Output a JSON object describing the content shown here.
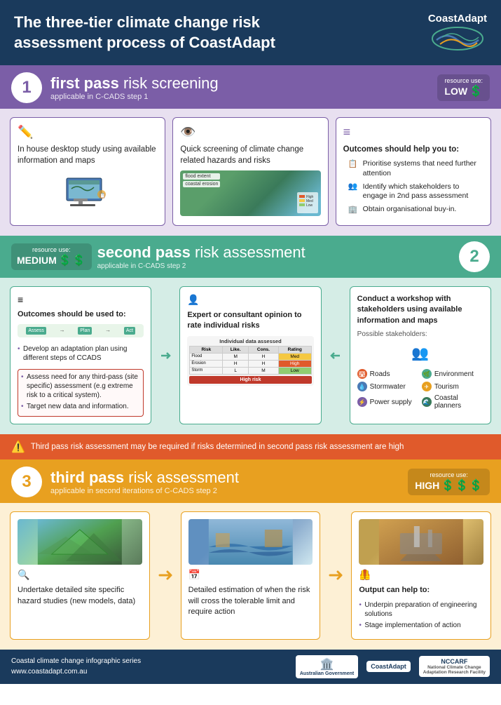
{
  "header": {
    "title": "The three-tier climate change risk assessment process of CoastAdapt",
    "logo_text": "CoastAdapt"
  },
  "first_pass": {
    "band_num": "1",
    "band_title_bold": "first pass",
    "band_title_rest": " risk screening",
    "band_subtitle": "applicable in C-CADS step 1",
    "resource_label": "resource use:",
    "resource_value": "LOW",
    "box1_title": "In house desktop study using available information and maps",
    "box2_title": "Quick screening of climate change related hazards and risks",
    "box3_title": "Outcomes should help you to:",
    "outcome1": "Prioritise systems that need further attention",
    "outcome2": "Identify which stakeholders to engage in 2nd pass assessment",
    "outcome3": "Obtain organisational buy-in."
  },
  "second_pass": {
    "band_num": "2",
    "band_title_bold": "second pass",
    "band_title_rest": " risk assessment",
    "band_subtitle": "applicable in C-CADS step 2",
    "resource_label": "resource use:",
    "resource_value": "MEDIUM",
    "box1_title": "Outcomes should be used to:",
    "box1_bullet1": "Develop an adaptation plan using different steps of CCADS",
    "box1_bullet2": "Assess need for any third-pass (site specific) assessment (e.g extreme risk to a critical system).",
    "box1_bullet3": "Target new data and information.",
    "box2_title": "Expert or consultant opinion to rate individual risks",
    "box3_title": "Conduct a workshop with stakeholders using available information and maps",
    "possible_stakeholders": "Possible stakeholders:",
    "s1": "Roads",
    "s2": "Environment",
    "s3": "Stormwater",
    "s4": "Tourism",
    "s5": "Power supply",
    "s6": "Coastal planners"
  },
  "warning": {
    "text": "Third pass risk assessment may be required if risks determined in second pass risk assessment are high"
  },
  "third_pass": {
    "band_num": "3",
    "band_title_bold": "third pass",
    "band_title_rest": " risk assessment",
    "band_subtitle": "applicable in second iterations of C-CADS step 2",
    "resource_label": "resource use:",
    "resource_value": "HIGH",
    "box1_title": "Undertake detailed site specific hazard studies (new models, data)",
    "box2_title": "Detailed estimation of when the risk will cross the tolerable limit and require action",
    "box3_title": "Output can help to:",
    "box3_bullet1": "Underpin preparation of engineering solutions",
    "box3_bullet2": "Stage implementation of action"
  },
  "footer": {
    "series": "Coastal climate change infographic series",
    "url": "www.coastadapt.com.au",
    "logo1": "Australian Government\nDepartment of the Environment and Energy",
    "logo2": "CoastAdapt",
    "logo3": "NCCARF\nNational\nClimate Change Adaptation\nResearch Facility"
  }
}
